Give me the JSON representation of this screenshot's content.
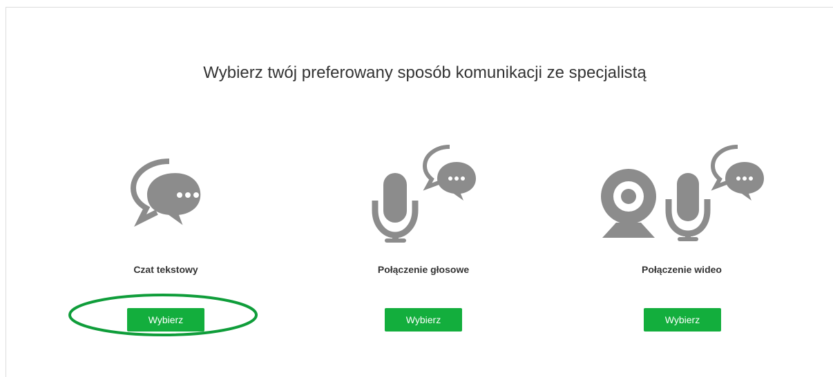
{
  "header": {
    "title": "Wybierz twój preferowany sposób komunikacji ze specjalistą"
  },
  "options": [
    {
      "label": "Czat tekstowy",
      "button_label": "Wybierz",
      "icon": "chat-bubbles-icon"
    },
    {
      "label": "Połączenie głosowe",
      "button_label": "Wybierz",
      "icon": "microphone-chat-icon"
    },
    {
      "label": "Połączenie wideo",
      "button_label": "Wybierz",
      "icon": "webcam-microphone-chat-icon"
    }
  ],
  "colors": {
    "button": "#13ae3d",
    "icon": "#8c8c8c",
    "highlight": "#0f9d3a"
  }
}
